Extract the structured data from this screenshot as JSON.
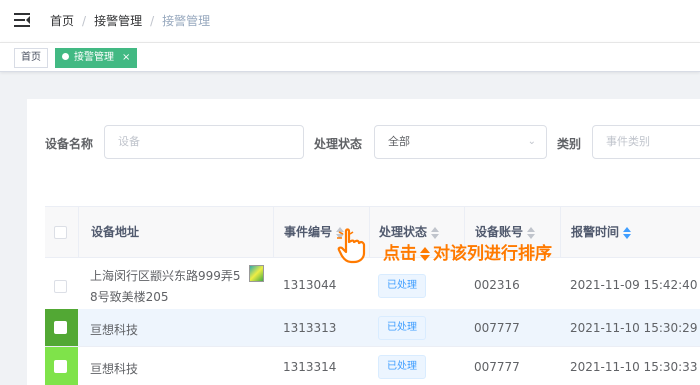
{
  "breadcrumb": [
    "首页",
    "接警管理",
    "接警管理"
  ],
  "tags": {
    "home": "首页",
    "active": "接警管理",
    "close": "×"
  },
  "filters": {
    "device_name_label": "设备名称",
    "device_name_placeholder": "设备",
    "status_label": "处理状态",
    "status_value": "全部",
    "category_label": "类别",
    "category_placeholder": "事件类别"
  },
  "table": {
    "headers": [
      "设备地址",
      "事件编号",
      "处理状态",
      "设备账号",
      "报警时间"
    ],
    "rows": [
      {
        "address_line1": "上海闵行区颛兴东路999弄5",
        "address_line2": "8号致美楼205",
        "event_no": "1313044",
        "status": "已处理",
        "account": "002316",
        "time": "2021-11-09 15:42:40"
      },
      {
        "address_line1": "亘想科技",
        "address_line2": "",
        "event_no": "1313313",
        "status": "已处理",
        "account": "007777",
        "time": "2021-11-10 15:30:29"
      },
      {
        "address_line1": "亘想科技",
        "address_line2": "",
        "event_no": "1313314",
        "status": "已处理",
        "account": "007777",
        "time": "2021-11-10 15:30:33"
      }
    ]
  },
  "tip": {
    "part1": "点击",
    "part2": "对该列进行排序"
  },
  "colors": {
    "accent_green": "#42b983",
    "tip_orange": "#ff7a00",
    "bright_green": "#7fe34a",
    "dark_green": "#52a834"
  }
}
